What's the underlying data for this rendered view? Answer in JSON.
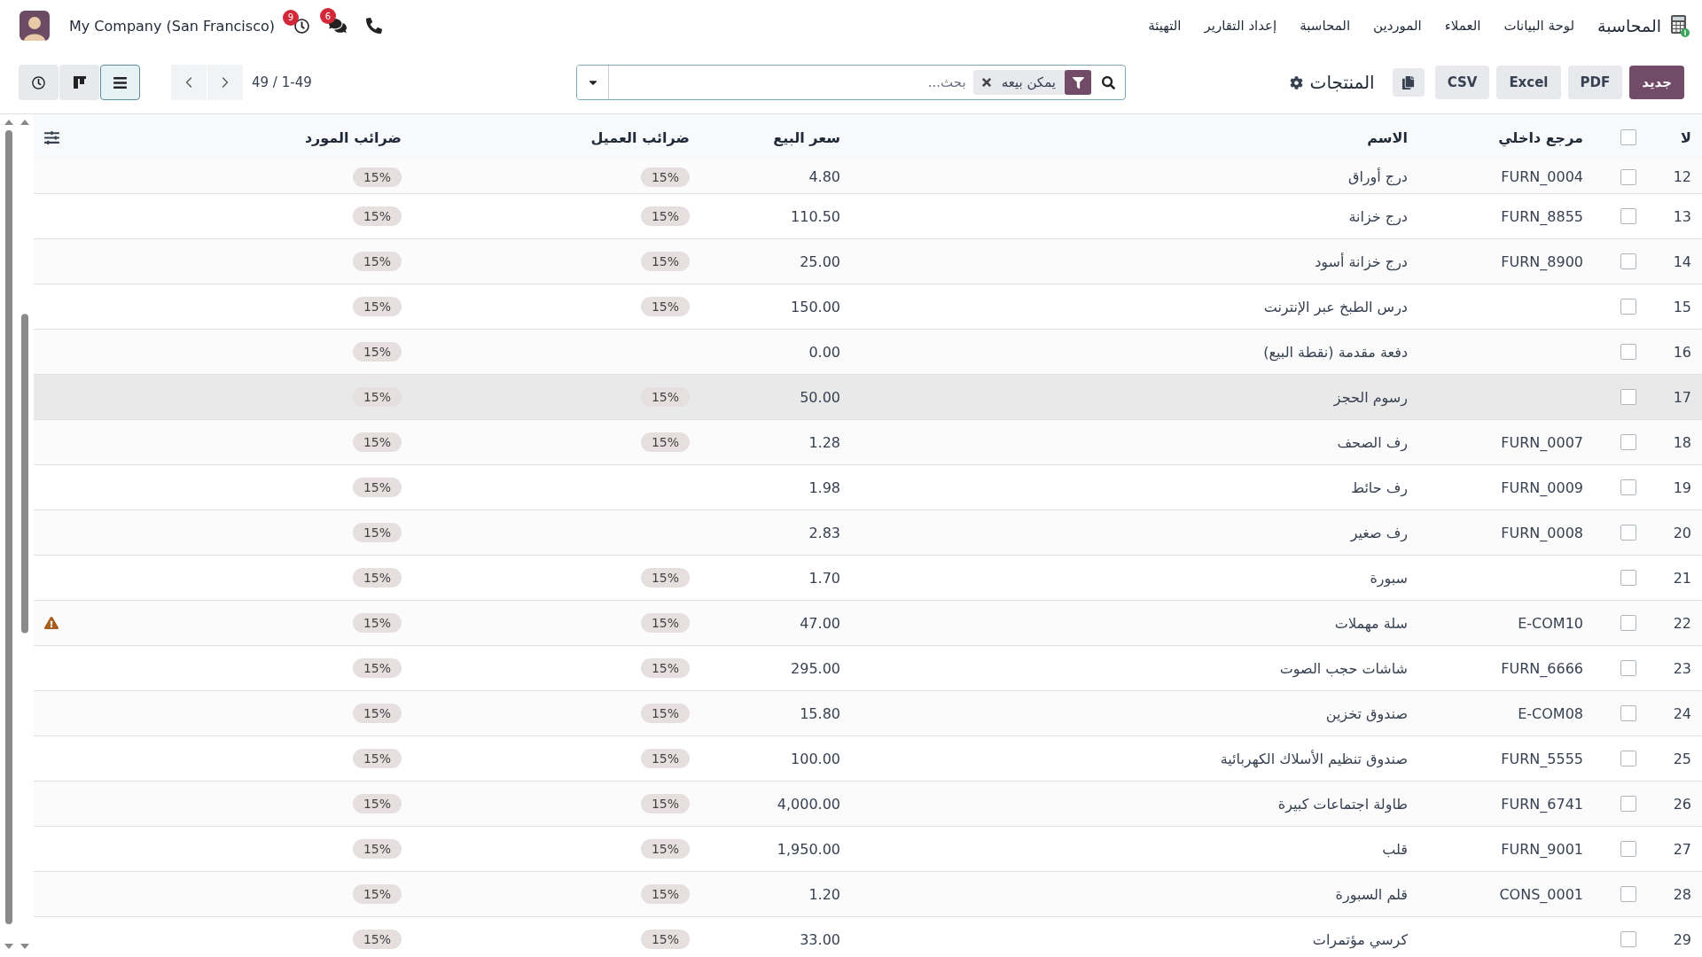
{
  "navbar": {
    "app_name": "المحاسبة",
    "menu": [
      "لوحة البيانات",
      "العملاء",
      "الموردين",
      "المحاسبة",
      "إعداد التقارير",
      "التهيئة"
    ],
    "systray": {
      "activity_count": "9",
      "messages_count": "6",
      "company": "My Company (San Francisco)"
    }
  },
  "toolbar": {
    "buttons": [
      {
        "label": "جديد",
        "kind": "primary"
      },
      {
        "label": "PDF",
        "kind": "secondary"
      },
      {
        "label": "Excel",
        "kind": "secondary"
      },
      {
        "label": "CSV",
        "kind": "secondary"
      }
    ],
    "title": "المنتجات",
    "search": {
      "placeholder": "بحث...",
      "facets": [
        {
          "label": "يمكن بيعه",
          "kind": "filter"
        }
      ]
    },
    "pager": {
      "value": "49 / 1-49"
    },
    "views": [
      {
        "kind": "list",
        "selected": true
      },
      {
        "kind": "kanban",
        "selected": false
      },
      {
        "kind": "activity",
        "selected": false
      }
    ]
  },
  "table": {
    "columns": [
      "لا",
      "مرجع داخلي",
      "الاسم",
      "سعر البيع",
      "ضرائب العميل",
      "ضرائب المورد"
    ],
    "select_all_checked": false,
    "rows": [
      {
        "no": "12",
        "ref": "FURN_0004",
        "name": "درج أوراق",
        "price": "4.80",
        "customer_tax": "15%",
        "vendor_tax": "15%",
        "checked": false,
        "hovered": false,
        "warning": false
      },
      {
        "no": "13",
        "ref": "FURN_8855",
        "name": "درج خزانة",
        "price": "110.50",
        "customer_tax": "15%",
        "vendor_tax": "15%",
        "checked": false,
        "hovered": false,
        "warning": false
      },
      {
        "no": "14",
        "ref": "FURN_8900",
        "name": "درج خزانة أسود",
        "price": "25.00",
        "customer_tax": "15%",
        "vendor_tax": "15%",
        "checked": false,
        "hovered": false,
        "warning": false
      },
      {
        "no": "15",
        "name": "درس الطبخ عبر الإنترنت",
        "price": "150.00",
        "customer_tax": "15%",
        "vendor_tax": "15%",
        "checked": false,
        "hovered": false,
        "warning": false
      },
      {
        "no": "16",
        "name": "دفعة مقدمة (نقطة البيع)",
        "price": "0.00",
        "vendor_tax": "15%",
        "checked": false,
        "hovered": false,
        "warning": false
      },
      {
        "no": "17",
        "name": "رسوم الحجز",
        "price": "50.00",
        "customer_tax": "15%",
        "vendor_tax": "15%",
        "checked": false,
        "hovered": true,
        "warning": false
      },
      {
        "no": "18",
        "ref": "FURN_0007",
        "name": "رف الصحف",
        "price": "1.28",
        "customer_tax": "15%",
        "vendor_tax": "15%",
        "checked": false,
        "hovered": false,
        "warning": false
      },
      {
        "no": "19",
        "ref": "FURN_0009",
        "name": "رف حائط",
        "price": "1.98",
        "vendor_tax": "15%",
        "checked": false,
        "hovered": false,
        "warning": false
      },
      {
        "no": "20",
        "ref": "FURN_0008",
        "name": "رف صغير",
        "price": "2.83",
        "vendor_tax": "15%",
        "checked": false,
        "hovered": false,
        "warning": false
      },
      {
        "no": "21",
        "name": "سبورة",
        "price": "1.70",
        "customer_tax": "15%",
        "vendor_tax": "15%",
        "checked": false,
        "hovered": false,
        "warning": false
      },
      {
        "no": "22",
        "ref": "E-COM10",
        "name": "سلة مهملات",
        "price": "47.00",
        "customer_tax": "15%",
        "vendor_tax": "15%",
        "checked": false,
        "hovered": false,
        "warning": true
      },
      {
        "no": "23",
        "ref": "FURN_6666",
        "name": "شاشات حجب الصوت",
        "price": "295.00",
        "customer_tax": "15%",
        "vendor_tax": "15%",
        "checked": false,
        "hovered": false,
        "warning": false
      },
      {
        "no": "24",
        "ref": "E-COM08",
        "name": "صندوق تخزين",
        "price": "15.80",
        "customer_tax": "15%",
        "vendor_tax": "15%",
        "checked": false,
        "hovered": false,
        "warning": false
      },
      {
        "no": "25",
        "ref": "FURN_5555",
        "name": "صندوق تنظيم الأسلاك الكهربائية",
        "price": "100.00",
        "customer_tax": "15%",
        "vendor_tax": "15%",
        "checked": false,
        "hovered": false,
        "warning": false
      },
      {
        "no": "26",
        "ref": "FURN_6741",
        "name": "طاولة اجتماعات كبيرة",
        "price": "4,000.00",
        "customer_tax": "15%",
        "vendor_tax": "15%",
        "checked": false,
        "hovered": false,
        "warning": false
      },
      {
        "no": "27",
        "ref": "FURN_9001",
        "name": "قلب",
        "price": "1,950.00",
        "customer_tax": "15%",
        "vendor_tax": "15%",
        "checked": false,
        "hovered": false,
        "warning": false
      },
      {
        "no": "28",
        "ref": "CONS_0001",
        "name": "قلم السبورة",
        "price": "1.20",
        "customer_tax": "15%",
        "vendor_tax": "15%",
        "checked": false,
        "hovered": false,
        "warning": false
      },
      {
        "no": "29",
        "name": "كرسي مؤتمرات",
        "price": "33.00",
        "customer_tax": "15%",
        "vendor_tax": "15%",
        "checked": false,
        "hovered": false,
        "warning": false
      }
    ]
  }
}
